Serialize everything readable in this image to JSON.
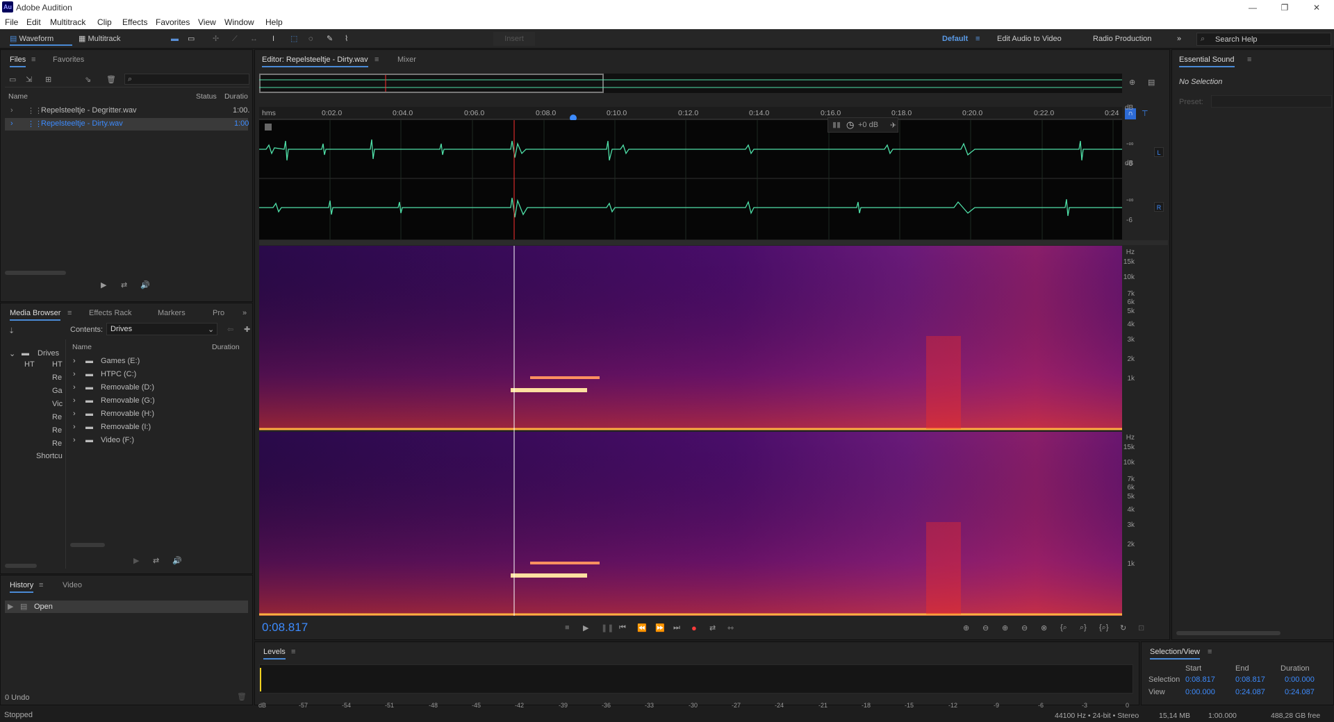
{
  "app": {
    "title": "Adobe Audition",
    "logo": "Au"
  },
  "menu": [
    "File",
    "Edit",
    "Multitrack",
    "Clip",
    "Effects",
    "Favorites",
    "View",
    "Window",
    "Help"
  ],
  "toolbar": {
    "waveform": "Waveform",
    "multitrack": "Multitrack",
    "insert": "Insert",
    "workspaces": [
      "Default",
      "Edit Audio to Video",
      "Radio Production"
    ],
    "search_placeholder": "Search Help"
  },
  "files_panel": {
    "tabs": [
      "Files",
      "Favorites"
    ],
    "col_name": "Name",
    "col_status": "Status",
    "col_duration": "Duratio",
    "items": [
      {
        "name": "Repelsteeltje - Degritter.wav",
        "duration": "1:00."
      },
      {
        "name": "Repelsteeltje - Dirty.wav",
        "duration": "1:00"
      }
    ]
  },
  "media_panel": {
    "tabs": [
      "Media Browser",
      "Effects Rack",
      "Markers",
      "Pro"
    ],
    "contents_label": "Contents:",
    "contents_value": "Drives",
    "tree_root": "Drives",
    "tree_children": [
      "HT",
      "Re",
      "Ga",
      "Vic",
      "Re",
      "Re",
      "Re"
    ],
    "tree_shortcuts": "Shortcu",
    "col_name": "Name",
    "col_duration": "Duration",
    "items": [
      "Games (E:)",
      "HTPC (C:)",
      "Removable (D:)",
      "Removable (G:)",
      "Removable (H:)",
      "Removable (I:)",
      "Video (F:)"
    ]
  },
  "history_panel": {
    "tabs": [
      "History",
      "Video"
    ],
    "item": "Open",
    "undo": "0 Undo"
  },
  "editor": {
    "tabs": [
      "Editor: Repelsteeltje - Dirty.wav",
      "Mixer"
    ],
    "ruler": [
      "hms",
      "0:02.0",
      "0:04.0",
      "0:06.0",
      "0:08.0",
      "0:10.0",
      "0:12.0",
      "0:14.0",
      "0:16.0",
      "0:18.0",
      "0:20.0",
      "0:22.0",
      "0:24"
    ],
    "gain": "+0 dB",
    "db_labels": [
      "dB",
      "-∞",
      "-6"
    ],
    "channels": [
      "L",
      "R"
    ],
    "hz_labels": [
      "Hz",
      "15k",
      "10k",
      "7k",
      "6k",
      "5k",
      "4k",
      "3k",
      "2k",
      "1k"
    ],
    "time": "0:08.817"
  },
  "essential_sound": {
    "title": "Essential Sound",
    "no_selection": "No Selection",
    "preset": "Preset:"
  },
  "levels": {
    "title": "Levels",
    "scale": [
      "dB",
      "-57",
      "-54",
      "-51",
      "-48",
      "-45",
      "-42",
      "-39",
      "-36",
      "-33",
      "-30",
      "-27",
      "-24",
      "-21",
      "-18",
      "-15",
      "-12",
      "-9",
      "-6",
      "-3",
      "0"
    ]
  },
  "selection_view": {
    "title": "Selection/View",
    "cols": [
      "Start",
      "End",
      "Duration"
    ],
    "rows": [
      {
        "label": "Selection",
        "start": "0:08.817",
        "end": "0:08.817",
        "duration": "0:00.000"
      },
      {
        "label": "View",
        "start": "0:00.000",
        "end": "0:24.087",
        "duration": "0:24.087"
      }
    ]
  },
  "status": {
    "state": "Stopped",
    "format": "44100 Hz • 24-bit • Stereo",
    "size": "15,14 MB",
    "duration": "1:00.000",
    "free": "488,28 GB free"
  },
  "colors": {
    "accent": "#3d8bfd",
    "waveform": "#4fe0a8",
    "playhead": "#ff3030"
  }
}
